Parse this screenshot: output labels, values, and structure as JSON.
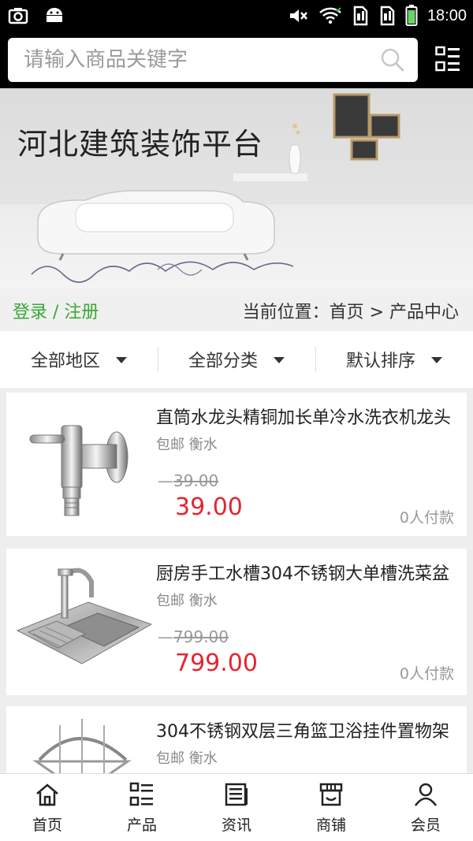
{
  "status_bar": {
    "time": "18:00"
  },
  "search": {
    "placeholder": "请输入商品关键字"
  },
  "banner": {
    "title": "河北建筑装饰平台"
  },
  "location": {
    "login": "登录 / 注册",
    "breadcrumb": "当前位置：首页 > 产品中心"
  },
  "filters": [
    {
      "label": "全部地区"
    },
    {
      "label": "全部分类"
    },
    {
      "label": "默认排序"
    }
  ],
  "products": [
    {
      "title": "直筒水龙头精铜加长单冷水洗衣机龙头",
      "meta": "包邮 衡水",
      "old_price": "39.00",
      "price": "39.00",
      "paid": "0人付款",
      "image": "faucet"
    },
    {
      "title": "厨房手工水槽304不锈钢大单槽洗菜盆",
      "meta": "包邮 衡水",
      "old_price": "799.00",
      "price": "799.00",
      "paid": "0人付款",
      "image": "kitchen-sink"
    },
    {
      "title": "304不锈钢双层三角篮卫浴挂件置物架",
      "meta": "包邮 衡水",
      "old_price": "",
      "price": "",
      "paid": "",
      "image": "corner-rack"
    }
  ],
  "bottom_nav": [
    {
      "label": "首页",
      "icon": "home-icon"
    },
    {
      "label": "产品",
      "icon": "product-grid-icon"
    },
    {
      "label": "资讯",
      "icon": "news-icon"
    },
    {
      "label": "商铺",
      "icon": "shop-icon"
    },
    {
      "label": "会员",
      "icon": "member-icon"
    }
  ],
  "colors": {
    "accent_green": "#3aa836",
    "price_red": "#e4252f",
    "header_bg": "#000000"
  }
}
